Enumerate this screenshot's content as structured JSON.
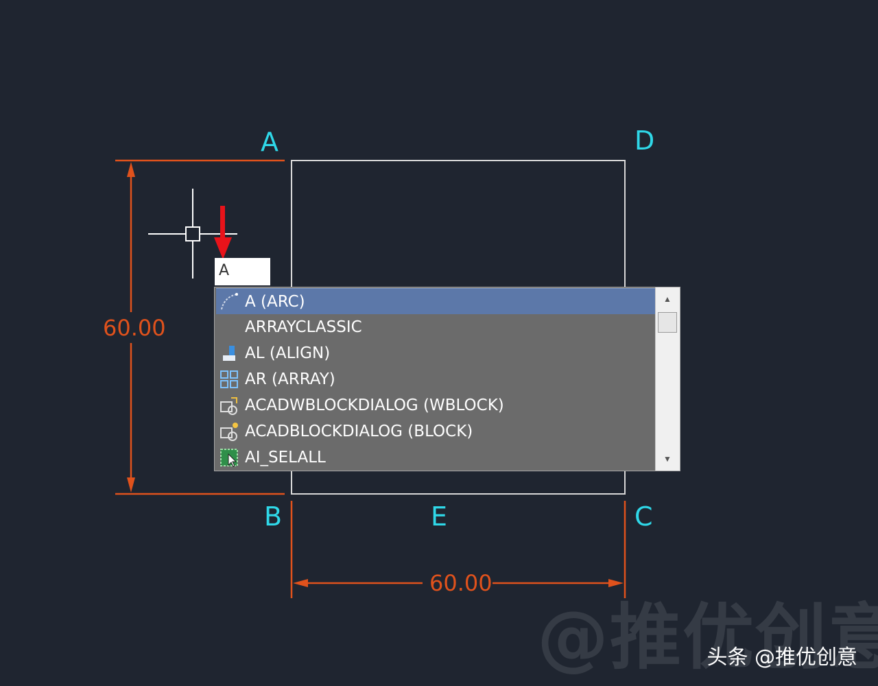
{
  "points": {
    "a": "A",
    "b": "B",
    "c": "C",
    "d": "D",
    "e": "E"
  },
  "dimensions": {
    "vertical": "60.00",
    "horizontal": "60.00"
  },
  "command_input": {
    "value": "A"
  },
  "autocomplete": {
    "items": [
      {
        "label": "A (ARC)",
        "icon": "arc-icon",
        "selected": true
      },
      {
        "label": "ARRAYCLASSIC",
        "icon": "none",
        "selected": false
      },
      {
        "label": "AL (ALIGN)",
        "icon": "align-icon",
        "selected": false
      },
      {
        "label": "AR (ARRAY)",
        "icon": "array-grid-icon",
        "selected": false
      },
      {
        "label": "ACADWBLOCKDIALOG (WBLOCK)",
        "icon": "wblock-icon",
        "selected": false
      },
      {
        "label": "ACADBLOCKDIALOG (BLOCK)",
        "icon": "block-icon",
        "selected": false
      },
      {
        "label": "AI_SELALL",
        "icon": "select-all-icon",
        "selected": false
      }
    ]
  },
  "watermark": {
    "overlay": "@推优创意",
    "credit": "头条 @推优创意"
  },
  "colors": {
    "background": "#1f2530",
    "point_label": "#2fd8e8",
    "dimension": "#e0521c",
    "selection": "#5c78a9",
    "popup": "#6b6b6b"
  }
}
